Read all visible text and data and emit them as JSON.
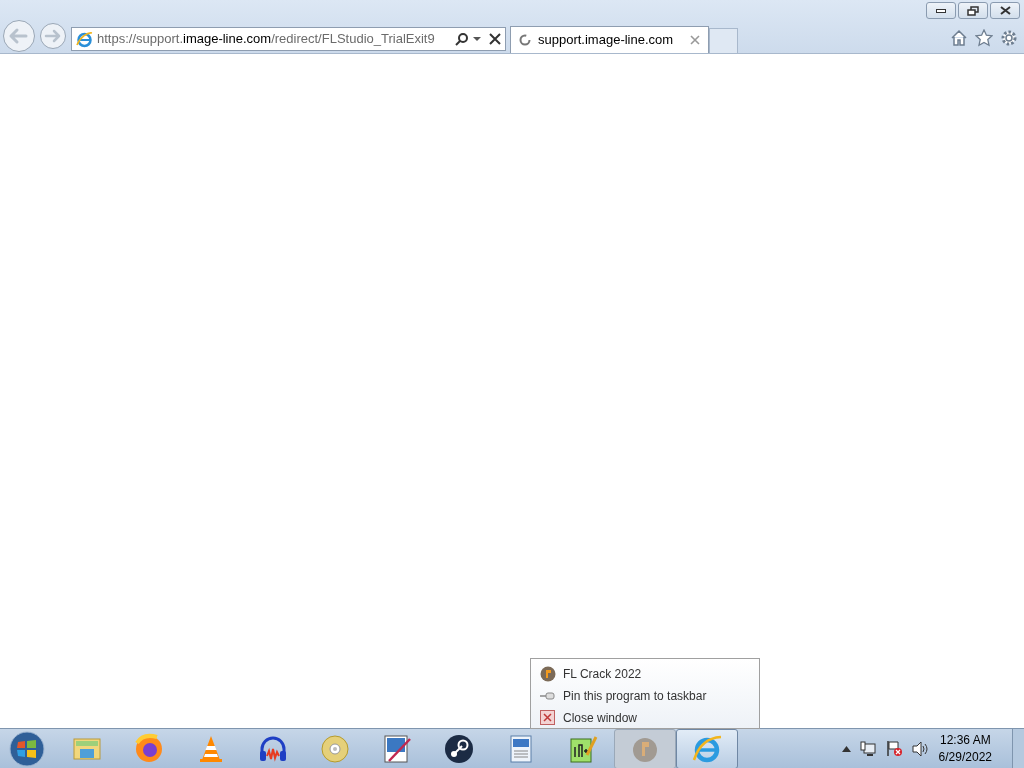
{
  "browser": {
    "address": "https://support.**image-line.com**/redirect/FLStudio_TrialExit9",
    "tabs": [
      {
        "label": "support.image-line.com",
        "selected": true,
        "loading": true
      }
    ]
  },
  "jump_list": {
    "items": [
      {
        "kind": "app",
        "label": "FL Crack 2022"
      },
      {
        "kind": "pin",
        "label": "Pin this program to taskbar"
      },
      {
        "kind": "close",
        "label": "Close window"
      }
    ]
  },
  "taskbar": {
    "items": [
      {
        "kind": "explorer",
        "hovered": false,
        "open": false
      },
      {
        "kind": "firefox",
        "hovered": false,
        "open": false
      },
      {
        "kind": "vlc",
        "hovered": false,
        "open": false
      },
      {
        "kind": "audio",
        "hovered": false,
        "open": false
      },
      {
        "kind": "disc",
        "hovered": false,
        "open": false
      },
      {
        "kind": "paint",
        "hovered": false,
        "open": false
      },
      {
        "kind": "steam",
        "hovered": false,
        "open": false
      },
      {
        "kind": "wordpad",
        "hovered": false,
        "open": false
      },
      {
        "kind": "notepad",
        "hovered": false,
        "open": false
      },
      {
        "kind": "fruit",
        "hovered": true,
        "open": false
      },
      {
        "kind": "ie",
        "hovered": false,
        "open": true
      }
    ],
    "clock": {
      "time": "12:36 AM",
      "date": "6/29/2022"
    }
  }
}
